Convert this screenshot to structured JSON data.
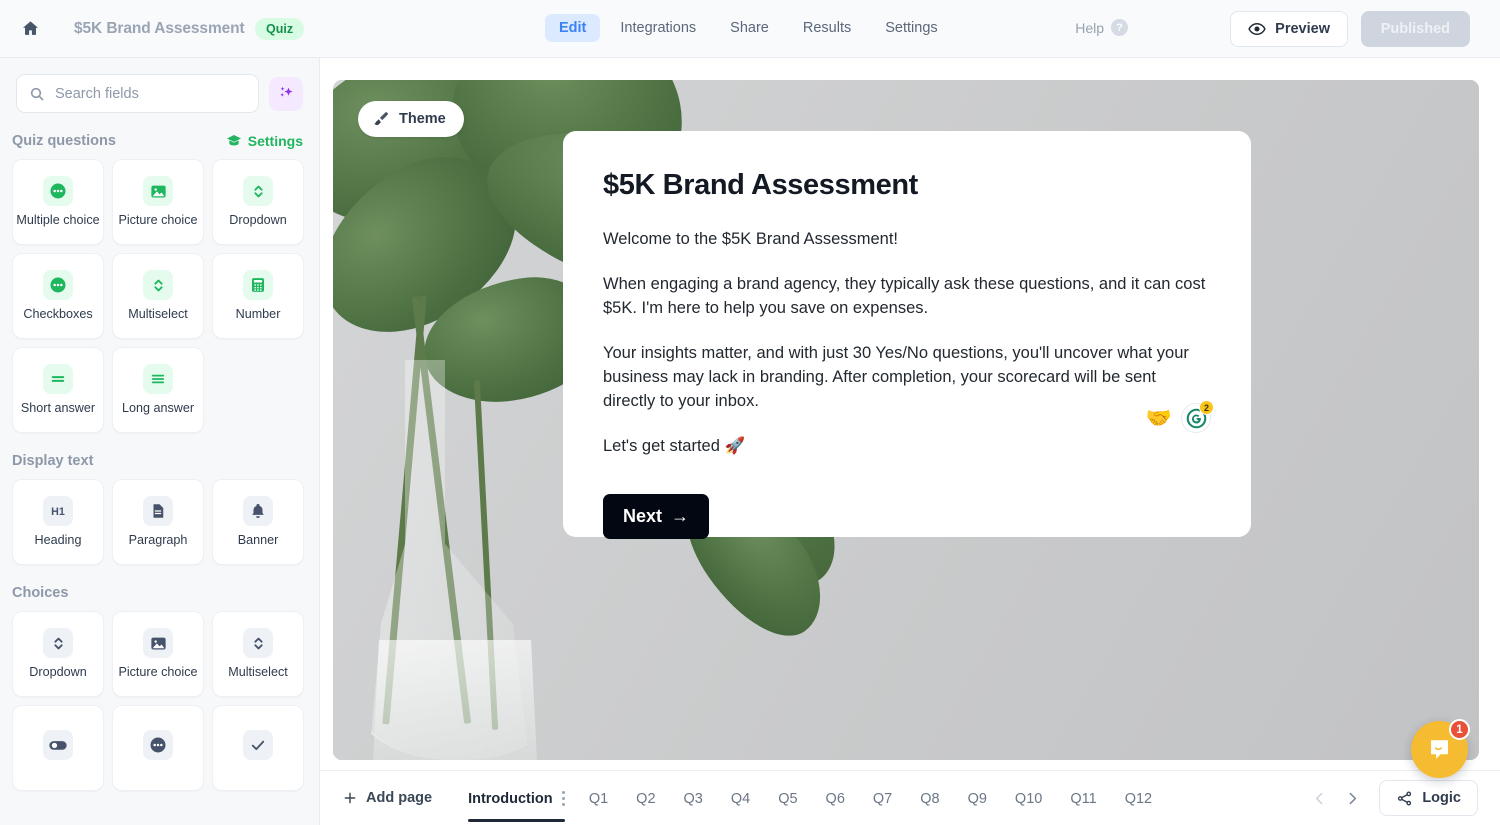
{
  "header": {
    "home_icon": "home-icon",
    "title": "$5K Brand Assessment",
    "badge": "Quiz",
    "tabs": [
      {
        "label": "Edit",
        "active": true
      },
      {
        "label": "Integrations",
        "active": false
      },
      {
        "label": "Share",
        "active": false
      },
      {
        "label": "Results",
        "active": false
      },
      {
        "label": "Settings",
        "active": false
      }
    ],
    "help_label": "Help",
    "help_icon": "question-mark-icon",
    "preview_label": "Preview",
    "preview_icon": "eye-icon",
    "published_label": "Published"
  },
  "sidebar": {
    "search": {
      "placeholder": "Search fields",
      "value": "",
      "icon": "search-icon"
    },
    "ai_button_icon": "sparkle-icon",
    "sections": [
      {
        "title": "Quiz questions",
        "action_label": "Settings",
        "action_icon": "graduation-cap-icon",
        "accent": "#22b45f",
        "fields": [
          {
            "label": "Multiple choice",
            "icon": "dots-circle-icon",
            "tone": "green"
          },
          {
            "label": "Picture choice",
            "icon": "image-icon",
            "tone": "green"
          },
          {
            "label": "Dropdown",
            "icon": "chevron-updown-icon",
            "tone": "green"
          },
          {
            "label": "Checkboxes",
            "icon": "dots-circle-icon",
            "tone": "green"
          },
          {
            "label": "Multiselect",
            "icon": "chevron-updown-icon",
            "tone": "green"
          },
          {
            "label": "Number",
            "icon": "calculator-icon",
            "tone": "green"
          },
          {
            "label": "Short answer",
            "icon": "short-lines-icon",
            "tone": "green"
          },
          {
            "label": "Long answer",
            "icon": "long-lines-icon",
            "tone": "green"
          }
        ]
      },
      {
        "title": "Display text",
        "action_label": "",
        "fields": [
          {
            "label": "Heading",
            "icon": "h1-icon",
            "tone": "slate"
          },
          {
            "label": "Paragraph",
            "icon": "document-icon",
            "tone": "slate"
          },
          {
            "label": "Banner",
            "icon": "bell-icon",
            "tone": "slate"
          }
        ]
      },
      {
        "title": "Choices",
        "action_label": "",
        "fields": [
          {
            "label": "Dropdown",
            "icon": "chevron-updown-icon",
            "tone": "slate"
          },
          {
            "label": "Picture choice",
            "icon": "image-icon",
            "tone": "slate"
          },
          {
            "label": "Multiselect",
            "icon": "chevron-updown-icon",
            "tone": "slate"
          },
          {
            "label": "",
            "icon": "toggle-icon",
            "tone": "slate"
          },
          {
            "label": "",
            "icon": "dots-circle-icon",
            "tone": "slate"
          },
          {
            "label": "",
            "icon": "check-icon",
            "tone": "slate"
          }
        ]
      }
    ]
  },
  "canvas": {
    "theme_chip": {
      "label": "Theme",
      "icon": "paintbrush-icon"
    },
    "form": {
      "title": "$5K Brand Assessment",
      "paragraphs": [
        "Welcome to the $5K Brand Assessment!",
        "When engaging a brand agency, they typically ask these questions, and it can cost $5K. I'm here to help you save on expenses.",
        "Your insights matter, and with just 30 Yes/No questions, you'll uncover what your business may lack in branding. After completion, your scorecard will be sent directly to your inbox.",
        "Let's get started 🚀"
      ],
      "next_label": "Next",
      "next_arrow": "→",
      "badges": [
        {
          "name": "handshake-emoji",
          "glyph": "🤝"
        },
        {
          "name": "g2-badge",
          "glyph": "G",
          "count": "2"
        }
      ]
    }
  },
  "bottom": {
    "add_page_label": "Add page",
    "add_page_icon": "plus-icon",
    "pages": [
      {
        "label": "Introduction",
        "active": true
      },
      {
        "label": "Q1",
        "active": false
      },
      {
        "label": "Q2",
        "active": false
      },
      {
        "label": "Q3",
        "active": false
      },
      {
        "label": "Q4",
        "active": false
      },
      {
        "label": "Q5",
        "active": false
      },
      {
        "label": "Q6",
        "active": false
      },
      {
        "label": "Q7",
        "active": false
      },
      {
        "label": "Q8",
        "active": false
      },
      {
        "label": "Q9",
        "active": false
      },
      {
        "label": "Q10",
        "active": false
      },
      {
        "label": "Q11",
        "active": false
      },
      {
        "label": "Q12",
        "active": false
      }
    ],
    "prev_icon": "chevron-left-icon",
    "next_icon": "chevron-right-icon",
    "logic_label": "Logic",
    "logic_icon": "share-nodes-icon"
  },
  "chat": {
    "icon": "chat-bubble-icon",
    "unread": "1"
  },
  "colors": {
    "accent_green": "#22b45f",
    "accent_blue": "#3b82f6",
    "badge_green_bg": "#d7fbe3",
    "chat_orange": "#f5bc32",
    "chat_badge_red": "#e8503a"
  }
}
